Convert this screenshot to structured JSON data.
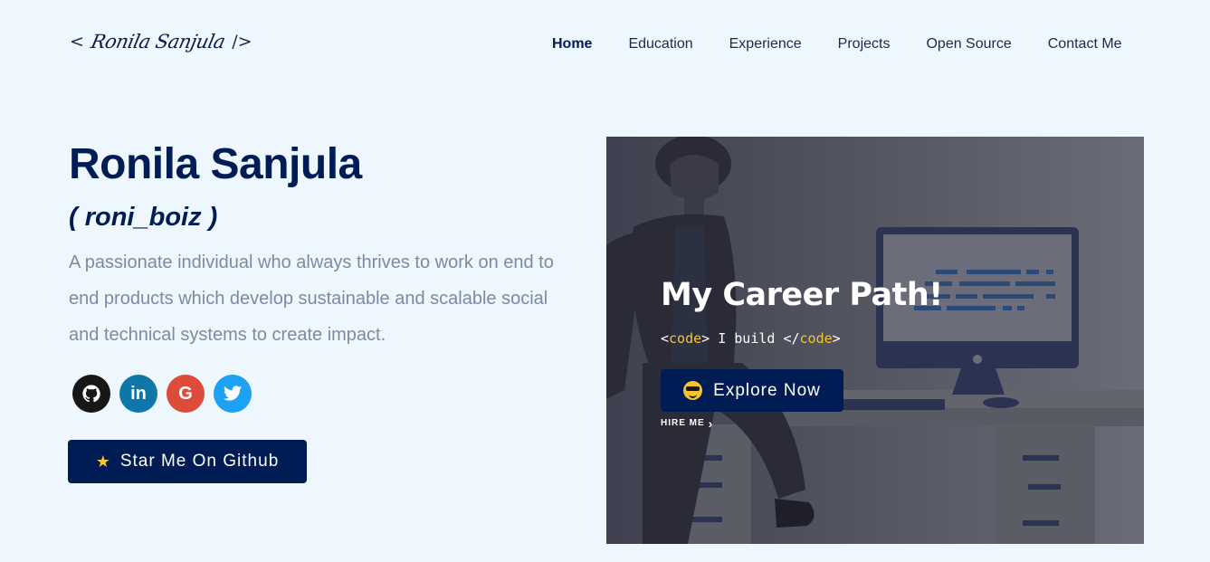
{
  "header": {
    "logo": {
      "open": "<",
      "signature": "Ronila Sanjula",
      "close": "/>"
    },
    "nav": [
      {
        "label": "Home",
        "active": true
      },
      {
        "label": "Education"
      },
      {
        "label": "Experience"
      },
      {
        "label": "Projects"
      },
      {
        "label": "Open Source"
      },
      {
        "label": "Contact Me"
      }
    ]
  },
  "hero": {
    "name": "Ronila Sanjula",
    "handle": "( roni_boiz )",
    "description": "A passionate individual who always thrives to work on end to end products which develop sustainable and scalable social and technical systems to create impact.",
    "socials": [
      {
        "name": "github",
        "icon": "github-icon",
        "glyph": "◉",
        "color": "#181717"
      },
      {
        "name": "linkedin",
        "icon": "linkedin-icon",
        "glyph": "in",
        "color": "#0e76a8"
      },
      {
        "name": "google",
        "icon": "google-icon",
        "glyph": "G",
        "color": "#dd4b39"
      },
      {
        "name": "twitter",
        "icon": "twitter-icon",
        "glyph": "✦",
        "color": "#1da1f2"
      }
    ],
    "star_button": {
      "icon": "★",
      "label": "Star Me On Github"
    }
  },
  "card": {
    "title": "My Career Path!",
    "code": {
      "open_lt": "<",
      "tag1": "code",
      "gt1": ">",
      "text": " I build ",
      "close_lt": "</",
      "tag2": "code",
      "gt2": ">"
    },
    "explore_button": {
      "label": "Explore Now"
    },
    "hire_me": {
      "label": "HIRE ME",
      "arrow": "›"
    }
  },
  "colors": {
    "background": "#eef7fd",
    "primary": "#001c55",
    "muted_text": "#7d8aa3",
    "accent": "#f7c331"
  }
}
